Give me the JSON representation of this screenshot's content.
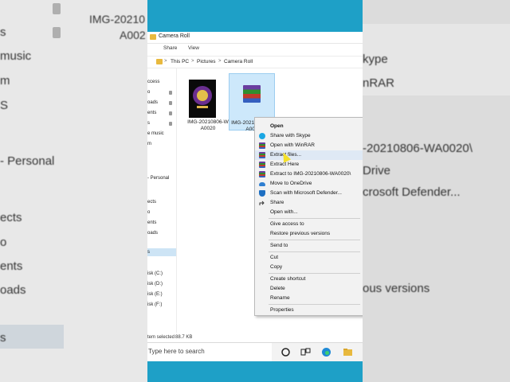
{
  "background": {
    "left_texts": [
      "s",
      "music",
      "m",
      "S",
      "- Personal",
      "ects",
      "o",
      "ents",
      "oads",
      "s"
    ],
    "right_texts": [
      "kype",
      "nRAR",
      "-20210806-WA0020\\",
      "Drive",
      "crosoft Defender...",
      "ous versions"
    ],
    "top_filename_1": "IMG-20210",
    "top_filename_2": "A002"
  },
  "window": {
    "title": "Camera Roll",
    "ribbon_tabs": [
      "Share",
      "View"
    ],
    "breadcrumb": [
      "This PC",
      "Pictures",
      "Camera Roll"
    ],
    "breadcrumb_separator": ">"
  },
  "nav_pane": {
    "items": [
      "ccess",
      "o",
      "oads",
      "ents",
      "s",
      "e music",
      "m",
      "- Personal",
      "ects",
      "o",
      "ents",
      "oads",
      "s",
      "isk (C:)",
      "isk (D:)",
      "isk (E:)",
      "isk (F:)"
    ]
  },
  "files": [
    {
      "name_line1": "IMG-20210806-W",
      "name_line2": "A0020",
      "type": "image",
      "selected": false
    },
    {
      "name_line1": "IMG-20210806-W",
      "name_line2": "A002",
      "type": "rar",
      "selected": true
    }
  ],
  "status": {
    "selection": "tem selected",
    "size": "88.7 KB"
  },
  "taskbar": {
    "search_placeholder": "Type here to search"
  },
  "context_menu": {
    "items": [
      {
        "label": "Open",
        "bold": true,
        "icon": "none"
      },
      {
        "label": "Share with Skype",
        "icon": "skype-icon"
      },
      {
        "label": "Open with WinRAR",
        "icon": "winrar-icon"
      },
      {
        "label": "Extract files...",
        "icon": "winrar-icon",
        "hover": true
      },
      {
        "label": "Extract Here",
        "icon": "winrar-icon"
      },
      {
        "label": "Extract to IMG-20210806-WA0020\\",
        "icon": "winrar-icon"
      },
      {
        "label": "Move to OneDrive",
        "icon": "onedrive-icon"
      },
      {
        "label": "Scan with Microsoft Defender...",
        "icon": "defender-icon"
      },
      {
        "label": "Share",
        "icon": "share-icon"
      },
      {
        "label": "Open with...",
        "icon": "none"
      },
      {
        "label": "Give access to",
        "icon": "none"
      },
      {
        "label": "Restore previous versions",
        "icon": "none"
      },
      {
        "label": "Send to",
        "icon": "none"
      },
      {
        "label": "Cut",
        "icon": "none"
      },
      {
        "label": "Copy",
        "icon": "none"
      },
      {
        "label": "Create shortcut",
        "icon": "none"
      },
      {
        "label": "Delete",
        "icon": "none"
      },
      {
        "label": "Rename",
        "icon": "none"
      },
      {
        "label": "Properties",
        "icon": "none"
      }
    ]
  },
  "colors": {
    "accent": "#1ea0c7",
    "selection": "#cde8fb",
    "menu_bg": "#f2f2f2",
    "cursor": "#f4e02a"
  }
}
